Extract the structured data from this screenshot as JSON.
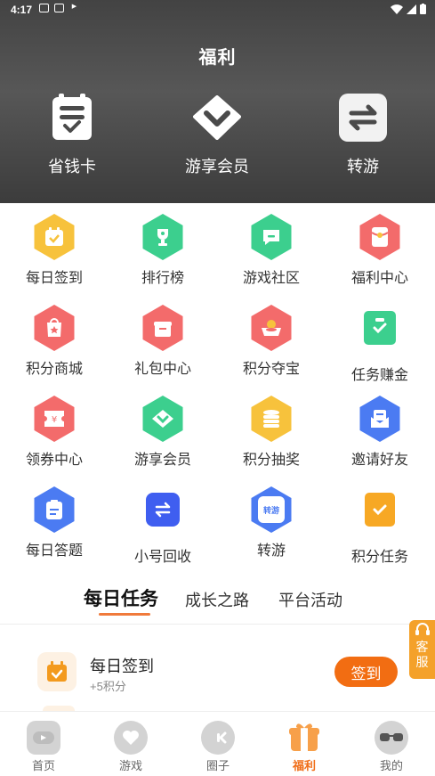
{
  "status_bar": {
    "time": "4:17"
  },
  "header": {
    "title": "福利",
    "shortcuts": [
      {
        "label": "省钱卡",
        "icon": "savings-card-icon"
      },
      {
        "label": "游享会员",
        "icon": "vip-diamond-icon"
      },
      {
        "label": "转游",
        "icon": "transfer-icon"
      }
    ]
  },
  "grid": [
    {
      "label": "每日签到",
      "icon": "daily-checkin-icon",
      "color": "#f7c23c"
    },
    {
      "label": "排行榜",
      "icon": "trophy-icon",
      "color": "#3ccf8e"
    },
    {
      "label": "游戏社区",
      "icon": "chat-icon",
      "color": "#3ccf8e"
    },
    {
      "label": "福利中心",
      "icon": "red-envelope-icon",
      "color": "#f36b6b"
    },
    {
      "label": "积分商城",
      "icon": "shopping-bag-icon",
      "color": "#f36b6b"
    },
    {
      "label": "礼包中心",
      "icon": "gift-box-icon",
      "color": "#f36b6b"
    },
    {
      "label": "积分夺宝",
      "icon": "treasure-icon",
      "color": "#f36b6b"
    },
    {
      "label": "任务赚金",
      "icon": "task-clipboard-icon",
      "color": "#3ccf8e"
    },
    {
      "label": "领券中心",
      "icon": "coupon-icon",
      "color": "#f36b6b"
    },
    {
      "label": "游享会员",
      "icon": "vip-diamond-icon",
      "color": "#3ccf8e"
    },
    {
      "label": "积分抽奖",
      "icon": "coin-stack-icon",
      "color": "#f7c23c"
    },
    {
      "label": "邀请好友",
      "icon": "invite-envelope-icon",
      "color": "#4b7bf2"
    },
    {
      "label": "每日答题",
      "icon": "quiz-clipboard-icon",
      "color": "#4b7bf2"
    },
    {
      "label": "小号回收",
      "icon": "recycle-icon",
      "color": "#3f5ef0"
    },
    {
      "label": "转游",
      "icon": "transfer-game-icon",
      "color": "#4b7bf2"
    },
    {
      "label": "积分任务",
      "icon": "points-task-icon",
      "color": "#f7a824"
    }
  ],
  "tabs": [
    {
      "label": "每日任务",
      "active": true
    },
    {
      "label": "成长之路",
      "active": false
    },
    {
      "label": "平台活动",
      "active": false
    }
  ],
  "task": {
    "title": "每日签到",
    "reward": "+5积分",
    "button": "签到"
  },
  "service": {
    "label_1": "客",
    "label_2": "服"
  },
  "bottom_nav": [
    {
      "label": "首页",
      "icon": "home-icon",
      "active": false
    },
    {
      "label": "游戏",
      "icon": "game-heart-icon",
      "active": false
    },
    {
      "label": "圈子",
      "icon": "community-icon",
      "active": false
    },
    {
      "label": "福利",
      "icon": "gift-icon",
      "active": true
    },
    {
      "label": "我的",
      "icon": "profile-icon",
      "active": false
    }
  ],
  "colors": {
    "accent": "#f26d12",
    "header_bg": "#4a4a4a",
    "tab_underline": "#f07a3b"
  }
}
